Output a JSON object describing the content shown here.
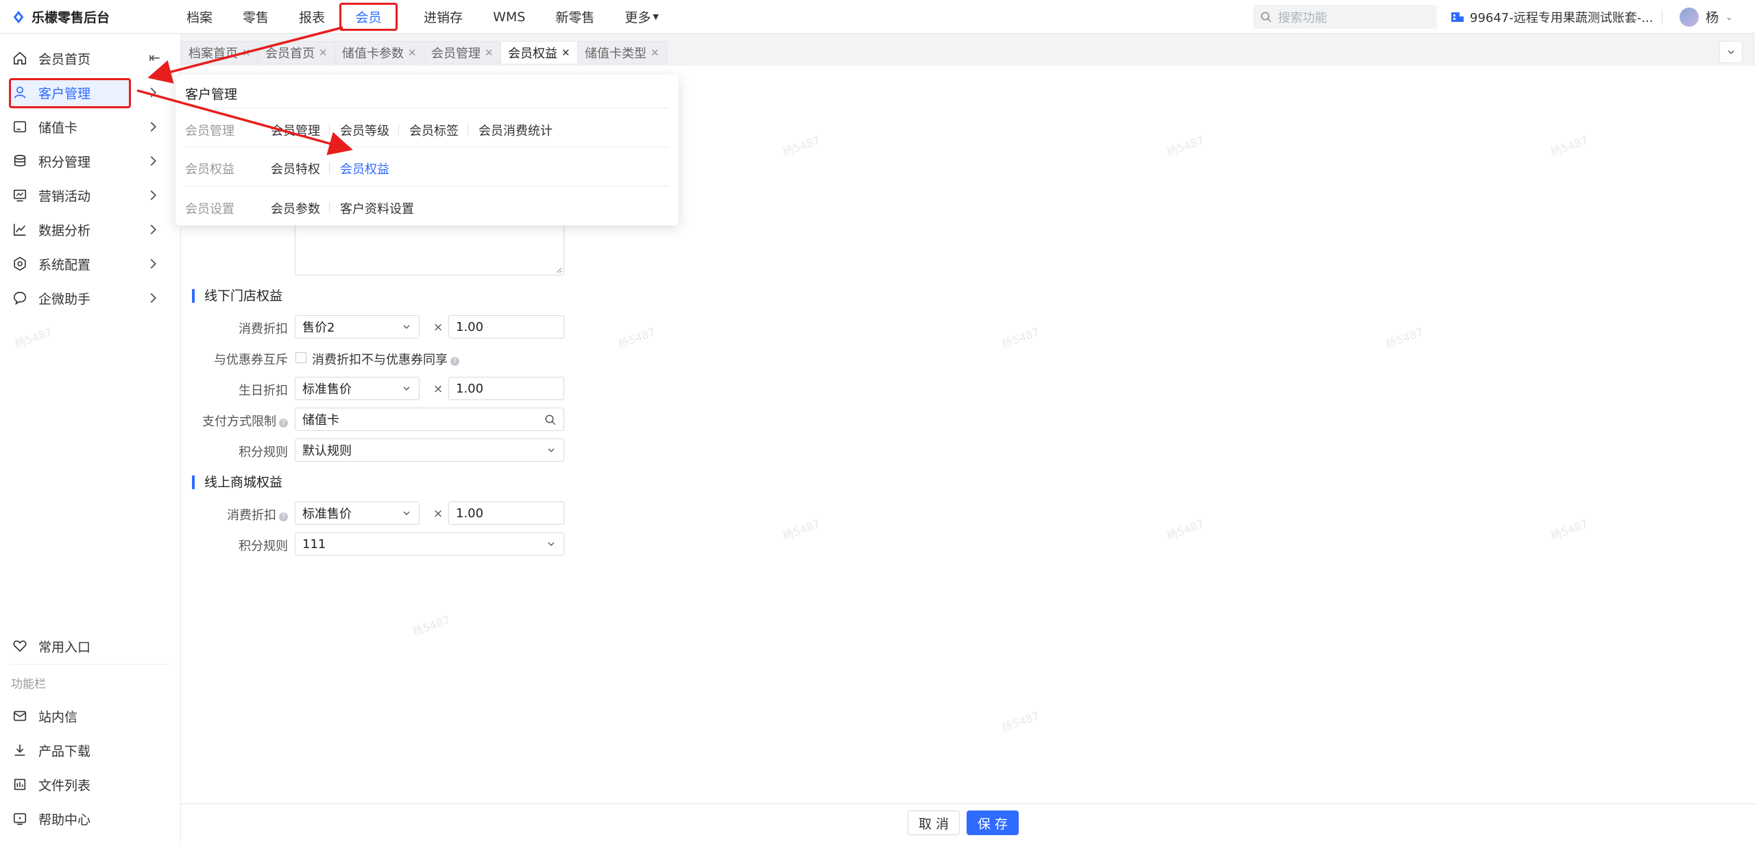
{
  "app": {
    "title": "乐檬零售后台"
  },
  "nav": {
    "items": [
      "档案",
      "零售",
      "报表"
    ],
    "member": "会员",
    "items_after": [
      "进销存",
      "WMS",
      "新零售"
    ],
    "more": "更多"
  },
  "search": {
    "placeholder": "搜索功能"
  },
  "account": {
    "name": "99647-远程专用果蔬测试账套-..."
  },
  "user": {
    "name": "杨"
  },
  "sidebar": {
    "items": [
      {
        "label": "会员首页",
        "icon": "home-icon"
      },
      {
        "label": "客户管理",
        "icon": "user-icon"
      },
      {
        "label": "储值卡",
        "icon": "card-icon"
      },
      {
        "label": "积分管理",
        "icon": "database-icon"
      },
      {
        "label": "营销活动",
        "icon": "monitor-icon"
      },
      {
        "label": "数据分析",
        "icon": "chart-icon"
      },
      {
        "label": "系统配置",
        "icon": "settings-icon"
      },
      {
        "label": "企微助手",
        "icon": "chat-icon"
      }
    ],
    "common": "常用入口",
    "function_bar": "功能栏",
    "bottom": [
      {
        "label": "站内信",
        "icon": "mail-icon"
      },
      {
        "label": "产品下载",
        "icon": "download-icon"
      },
      {
        "label": "文件列表",
        "icon": "file-list-icon"
      },
      {
        "label": "帮助中心",
        "icon": "help-icon"
      }
    ]
  },
  "tabs": [
    "档案首页",
    "会员首页",
    "储值卡参数",
    "会员管理",
    "会员权益",
    "储值卡类型"
  ],
  "active_tab": "会员权益",
  "panel": {
    "title": "客户管理",
    "rows": [
      {
        "category": "会员管理",
        "links": [
          "会员管理",
          "会员等级",
          "会员标签",
          "会员消费统计"
        ]
      },
      {
        "category": "会员权益",
        "links": [
          "会员特权",
          "会员权益"
        ]
      },
      {
        "category": "会员设置",
        "links": [
          "会员参数",
          "客户资料设置"
        ]
      }
    ]
  },
  "form": {
    "offline": {
      "title": "线下门店权益",
      "discount_label": "消费折扣",
      "discount_select": "售价2",
      "discount_value": "1.00",
      "coupon_label": "与优惠券互斥",
      "coupon_checkbox": "消费折扣不与优惠券同享",
      "birthday_label": "生日折扣",
      "birthday_select": "标准售价",
      "birthday_value": "1.00",
      "payment_label": "支付方式限制",
      "payment_value": "储值卡",
      "points_label": "积分规则",
      "points_value": "默认规则"
    },
    "online": {
      "title": "线上商城权益",
      "discount_label": "消费折扣",
      "discount_select": "标准售价",
      "discount_value": "1.00",
      "points_label": "积分规则",
      "points_value": "111"
    },
    "times": "×"
  },
  "footer": {
    "cancel": "取 消",
    "save": "保 存"
  },
  "watermark": "杨5487",
  "colors": {
    "accent": "#2f6bff",
    "annotation": "#e81e1e"
  }
}
